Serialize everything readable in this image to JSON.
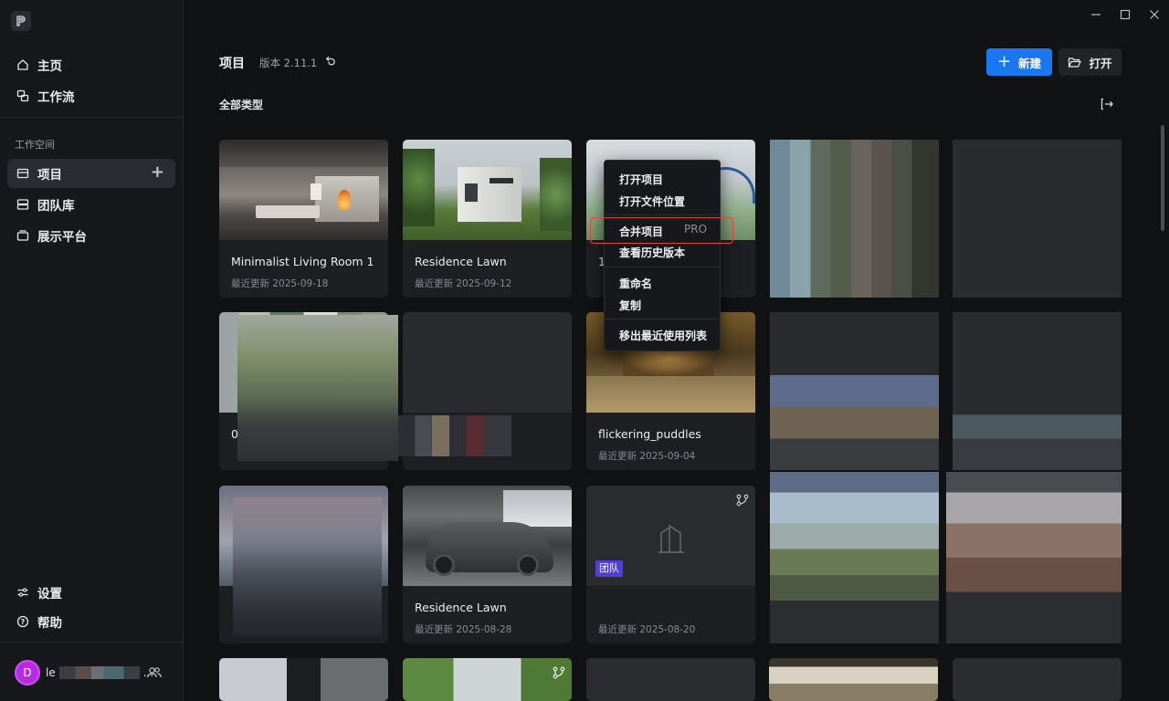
{
  "sidebar": {
    "nav": [
      {
        "label": "主页",
        "icon": "home-icon"
      },
      {
        "label": "工作流",
        "icon": "workflow-icon"
      }
    ],
    "workspace_label": "工作空间",
    "workspace_items": [
      {
        "label": "项目",
        "icon": "project-icon",
        "active": true
      },
      {
        "label": "团队库",
        "icon": "team-library-icon"
      },
      {
        "label": "展示平台",
        "icon": "showcase-icon"
      }
    ],
    "bottom_items": [
      {
        "label": "设置",
        "icon": "settings-icon"
      },
      {
        "label": "帮助",
        "icon": "help-icon"
      }
    ],
    "user": {
      "avatar_letter": "D",
      "name_prefix": "le",
      "name_suffix": "..."
    }
  },
  "header": {
    "title": "项目",
    "version": "版本 2.11.1",
    "new_label": "新建",
    "open_label": "打开",
    "filter_label": "全部类型"
  },
  "cards": [
    {
      "title": "Minimalist Living Room 1",
      "date": "最近更新 2025-09-18"
    },
    {
      "title": "Residence Lawn",
      "date": "最近更新 2025-09-12"
    },
    {
      "title": "1",
      "date": ""
    },
    {
      "title": "0",
      "date": ""
    },
    {
      "title": "flickering_puddles",
      "date": "最近更新 2025-09-04"
    },
    {
      "title": "Residence Lawn",
      "date": "最近更新 2025-08-28"
    },
    {
      "title": "",
      "date": "最近更新 2025-08-20",
      "badge": "团队"
    }
  ],
  "context_menu": {
    "items": [
      "打开项目",
      "打开文件位置",
      "合并项目",
      "查看历史版本",
      "重命名",
      "复制",
      "移出最近使用列表"
    ],
    "pro_label": "PRO"
  },
  "colors": {
    "accent": "#1977f2",
    "team_badge": "#4f3fe0",
    "highlight": "#e2453b",
    "avatar": "#b52ce0"
  }
}
